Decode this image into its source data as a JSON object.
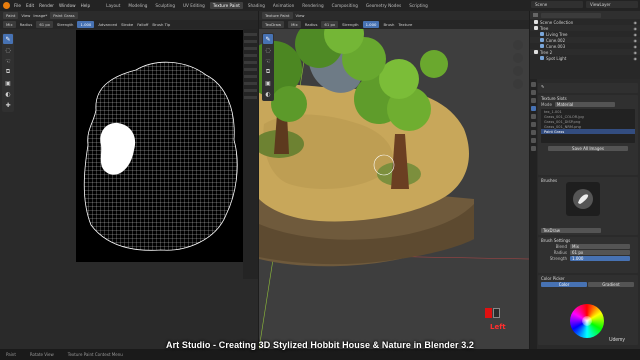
{
  "topbar": {
    "menus": [
      "File",
      "Edit",
      "Render",
      "Window",
      "Help"
    ],
    "workspaces": [
      "Layout",
      "Modeling",
      "Sculpting",
      "UV Editing",
      "Texture Paint",
      "Shading",
      "Animation",
      "Rendering",
      "Compositing",
      "Geometry Nodes",
      "Scripting"
    ],
    "active_workspace": "Texture Paint",
    "scene": "Scene",
    "view_layer": "ViewLayer"
  },
  "uv_editor": {
    "header": [
      "Paint",
      "View",
      "Image*"
    ],
    "image_name": "Paint Grass",
    "tool_settings": [
      {
        "label": "Mix"
      },
      {
        "label": "Radius",
        "value": "61 px"
      },
      {
        "label": "Strength",
        "value": "1.000",
        "blue": true
      },
      {
        "label": "Advanced"
      },
      {
        "label": "Stroke"
      },
      {
        "label": "Falloff"
      },
      {
        "label": "Brush Tip"
      }
    ]
  },
  "viewport": {
    "header": [
      "Texture Paint",
      "View"
    ],
    "tool_settings": [
      {
        "label": "TexDraw"
      },
      {
        "label": "Mix"
      },
      {
        "label": "Radius",
        "value": "61 px"
      },
      {
        "label": "Strength",
        "value": "1.000",
        "blue": true
      },
      {
        "label": "Brush"
      },
      {
        "label": "Texture"
      }
    ],
    "view_label": "Left"
  },
  "outliner": {
    "title": "Scene Collection",
    "items": [
      {
        "label": "Scene Collection",
        "type": "coll"
      },
      {
        "label": "Tree",
        "type": "coll"
      },
      {
        "label": "Living Tree",
        "type": "obj"
      },
      {
        "label": "Cone.002",
        "type": "obj"
      },
      {
        "label": "Cone.003",
        "type": "obj"
      },
      {
        "label": "Tree 2",
        "type": "coll"
      },
      {
        "label": "Spot Light",
        "type": "obj"
      }
    ]
  },
  "properties": {
    "tabs_active": 3,
    "texture_slots_title": "Texture Slots",
    "mode_label": "Mode",
    "mode_value": "Material",
    "slots": [
      "tex_1.001",
      "Grass_001_COLOR.jpg",
      "Grass_001_DISP.png",
      "Grass_001_NRM.png",
      "Paint Grass"
    ],
    "selected_slot": "Paint Grass",
    "save_button": "Save All Images",
    "brushes_title": "Brushes",
    "brush_name": "TexDraw",
    "brush_settings_title": "Brush Settings",
    "blend_label": "Blend",
    "blend_value": "Mix",
    "radius_label": "Radius",
    "radius_value": "61 px",
    "strength_label": "Strength",
    "strength_value": "1.000",
    "color_picker_title": "Color Picker",
    "color_tab": "Color",
    "gradient_tab": "Gradient"
  },
  "status_bar": [
    "Paint",
    "Rotate View",
    "Texture Paint Context Menu"
  ],
  "caption": "Art Studio - Creating 3D Stylized Hobbit House & Nature in Blender 3.2",
  "watermark": "Udemy",
  "colors": {
    "accent": "#4772b3",
    "active_tab_bg": "#3f3f3f",
    "key_red": "#e01010"
  }
}
